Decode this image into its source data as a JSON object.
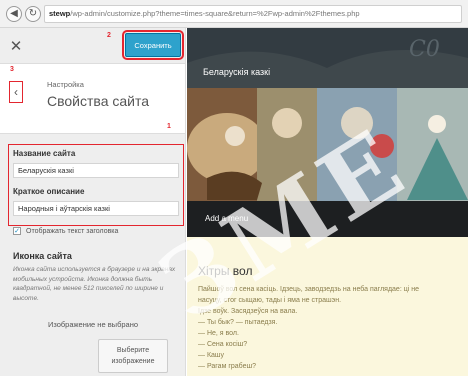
{
  "browser": {
    "url_host": "stewp",
    "url_path": "/wp-admin/customize.php?theme=times-square&return=%2Fwp-admin%2Fthemes.php"
  },
  "customizer": {
    "save_label": "Сохранить",
    "markers": [
      "1",
      "2",
      "3"
    ],
    "breadcrumb": "Настройка",
    "section_title": "Свойства сайта",
    "site_title_label": "Название сайта",
    "site_title_value": "Беларускія казкі",
    "tagline_label": "Краткое описание",
    "tagline_value": "Народныя і аўтарскія казкі",
    "display_header_text": "Отображать текст заголовка",
    "site_icon_title": "Иконка сайта",
    "site_icon_desc": "Иконка сайта используется в браузере и на экранах мобильных устройств. Иконка должна быть квадратной, не менее 512 пикселей по ширине и высоте.",
    "no_image": "Изображение не выбрано",
    "choose_lines": [
      "Выберите",
      "изображение"
    ]
  },
  "preview": {
    "site_title": "Беларускія казкі",
    "menu_link": "Add a menu",
    "post_title": "Хітры вол",
    "post_lines": [
      "Пайшоў вол сена касіць. Ідзець, заводзедзь на неба паглядае: ці не",
      "насуцу, стог сыщаю, тады і яма не страшэн.",
      "Ідзе воўк. Засядзеўся на вала.",
      "— Ты бык? — пытаедзя.",
      "— Не, я вол.",
      "— Сена косіш?",
      "— Кашу",
      "— Рагам грабеш?"
    ]
  },
  "watermark": "ЗМЕ"
}
